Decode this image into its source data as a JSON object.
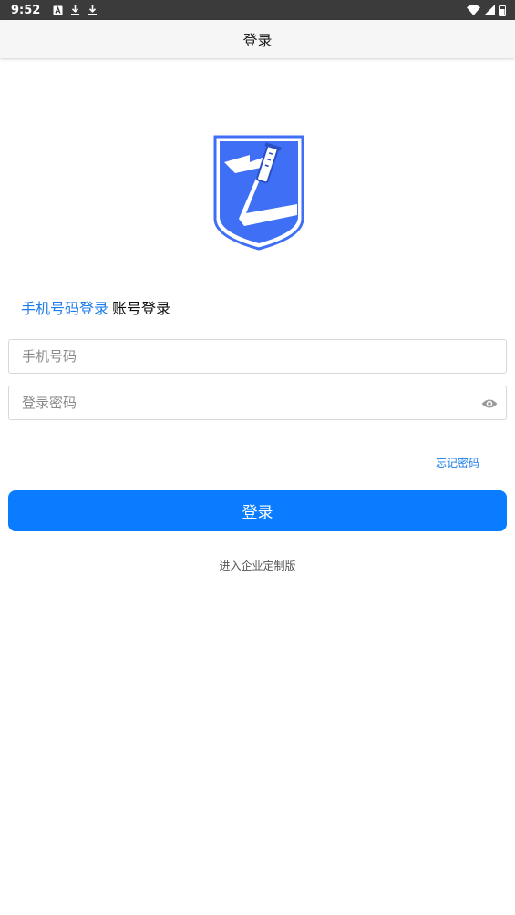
{
  "status_bar": {
    "time": "9:52",
    "left_icons": [
      "a-box-icon",
      "download-icon",
      "download-icon"
    ],
    "right_icons": [
      "wifi-icon",
      "signal-icon",
      "battery-icon"
    ]
  },
  "app_bar": {
    "title": "登录"
  },
  "login_tabs": {
    "phone_login": "手机号码登录",
    "account_login": "账号登录"
  },
  "form": {
    "phone_placeholder": "手机号码",
    "password_placeholder": "登录密码",
    "forgot_password": "忘记密码",
    "login_button": "登录",
    "enterprise_link": "进入企业定制版"
  },
  "colors": {
    "accent": "#1e7ce8",
    "button": "#0a7cff",
    "logo_blue": "#3f6ff5"
  }
}
